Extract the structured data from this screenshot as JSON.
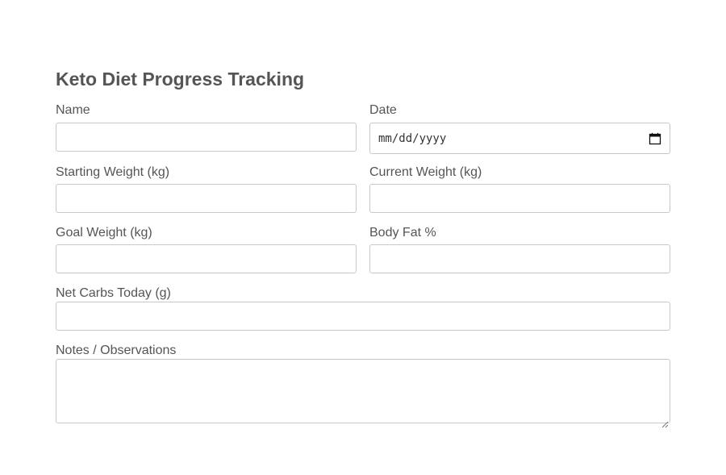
{
  "form": {
    "title": "Keto Diet Progress Tracking",
    "fields": {
      "name": {
        "label": "Name",
        "value": ""
      },
      "date": {
        "label": "Date",
        "value": "",
        "placeholder": "mm/dd/yyyy"
      },
      "starting_weight": {
        "label": "Starting Weight (kg)",
        "value": ""
      },
      "current_weight": {
        "label": "Current Weight (kg)",
        "value": ""
      },
      "goal_weight": {
        "label": "Goal Weight (kg)",
        "value": ""
      },
      "body_fat": {
        "label": "Body Fat %",
        "value": ""
      },
      "net_carbs": {
        "label": "Net Carbs Today (g)",
        "value": ""
      },
      "notes": {
        "label": "Notes / Observations",
        "value": ""
      }
    }
  },
  "icons": {
    "date_picker": "calendar-icon",
    "textarea_resize": "resize-grip-icon"
  },
  "colors": {
    "text": "#555555",
    "border": "#c8c8c8",
    "background": "#ffffff"
  }
}
